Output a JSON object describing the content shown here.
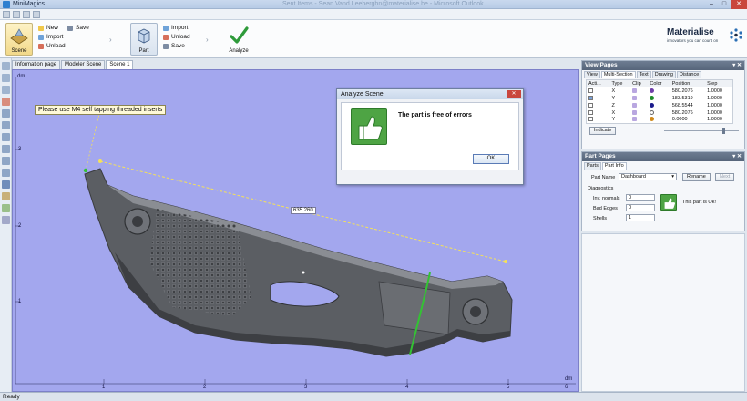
{
  "window": {
    "title": "MiniMagics",
    "ghost_title": "Sent Items - Sean.Vand.Leebergbn@materialise.be - Microsoft Outlook",
    "minimize": "–",
    "maximize": "□",
    "close": "✕"
  },
  "ribbon": {
    "scene_label": "Scene",
    "scene_items": [
      "New",
      "Import",
      "Unload"
    ],
    "save_label": "Save",
    "part_label": "Part",
    "part_items": [
      "Import",
      "Unload",
      "Save"
    ],
    "analyze_label": "Analyze",
    "chevron": "›"
  },
  "brand": {
    "name": "Materialise",
    "tagline": "innovators you can count on"
  },
  "doc_tabs": [
    "Information page",
    "Modeler Scene",
    "Scene 1"
  ],
  "viewport": {
    "note": "Please use M4 self tapping threaded inserts",
    "dimension": "635.260",
    "axis_unit_y": "dm",
    "axis_unit_x": "dm",
    "y_ticks": [
      "3",
      "2",
      "1"
    ],
    "x_ticks": [
      "1",
      "2",
      "3",
      "4",
      "5",
      "6"
    ],
    "bg_color": "#a3a7ee",
    "part_color": "#5a5d62"
  },
  "dialog": {
    "title": "Analyze Scene",
    "message": "The part is free of errors",
    "ok": "OK",
    "close": "✕"
  },
  "view_pages": {
    "title": "View Pages",
    "controls": "▾ ✕",
    "tabs": [
      "View",
      "Multi-Section",
      "Text",
      "Drawing",
      "Distance"
    ],
    "columns": [
      "Acti...",
      "Type",
      "Clip",
      "Color",
      "Position",
      "Step"
    ],
    "rows": [
      {
        "active": false,
        "type": "X",
        "clip": "",
        "color": "#6f3fa8",
        "position": "580.2076",
        "step": "1.0000"
      },
      {
        "active": true,
        "type": "Y",
        "clip": "",
        "color": "#1e8c2a",
        "position": "183.5319",
        "step": "1.0000"
      },
      {
        "active": false,
        "type": "Z",
        "clip": "",
        "color": "#1b1b8c",
        "position": "568.5544",
        "step": "1.0000"
      },
      {
        "active": false,
        "type": "X",
        "clip": "",
        "color": "#ffffff",
        "position": "580.2076",
        "step": "1.0000"
      },
      {
        "active": false,
        "type": "Y",
        "clip": "",
        "color": "#d08a1c",
        "position": "0.0000",
        "step": "1.0000"
      }
    ],
    "indicate": "Indicate"
  },
  "part_pages": {
    "title": "Part Pages",
    "controls": "▾ ✕",
    "tabs": [
      "Parts",
      "Part Info"
    ],
    "part_name_label": "Part Name",
    "part_name_value": "Dashboard",
    "rename": "Rename",
    "next": "Next",
    "diagnostics_label": "Diagnostics",
    "inv_normals_label": "Inv. normals",
    "inv_normals_value": "0",
    "bad_edges_label": "Bad Edges",
    "bad_edges_value": "0",
    "shells_label": "Shells",
    "shells_value": "1",
    "ok_text": "This part is Ok!"
  },
  "status": "Ready"
}
